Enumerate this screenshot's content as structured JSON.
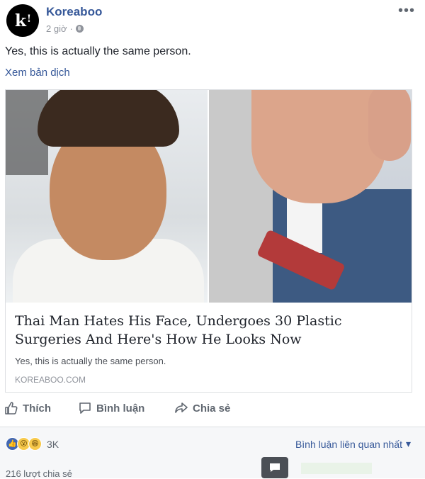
{
  "post": {
    "page_name": "Koreaboo",
    "avatar_text": "k",
    "avatar_mark": "!",
    "time": "2 giờ",
    "more_label": "•••",
    "status_text": "Yes, this is actually the same person.",
    "translate_label": "Xem bản dịch"
  },
  "link": {
    "title": "Thai Man Hates His Face, Undergoes 30 Plastic Surgeries And Here's How He Looks Now",
    "description": "Yes, this is actually the same person.",
    "domain": "KOREABOO.COM"
  },
  "actions": {
    "like_label": "Thích",
    "comment_label": "Bình luận",
    "share_label": "Chia sẻ"
  },
  "stats": {
    "reaction_count": "3K",
    "sort_label": "Bình luận liên quan nhất",
    "shares_text": "216 lượt chia sẻ"
  },
  "icons": [
    "globe-icon",
    "more-icon",
    "like-icon",
    "comment-icon",
    "share-icon",
    "chevron-down-icon",
    "chat-icon"
  ],
  "colors": {
    "link_blue": "#365899",
    "like_blue": "#4267b2",
    "muted": "#90949c"
  }
}
